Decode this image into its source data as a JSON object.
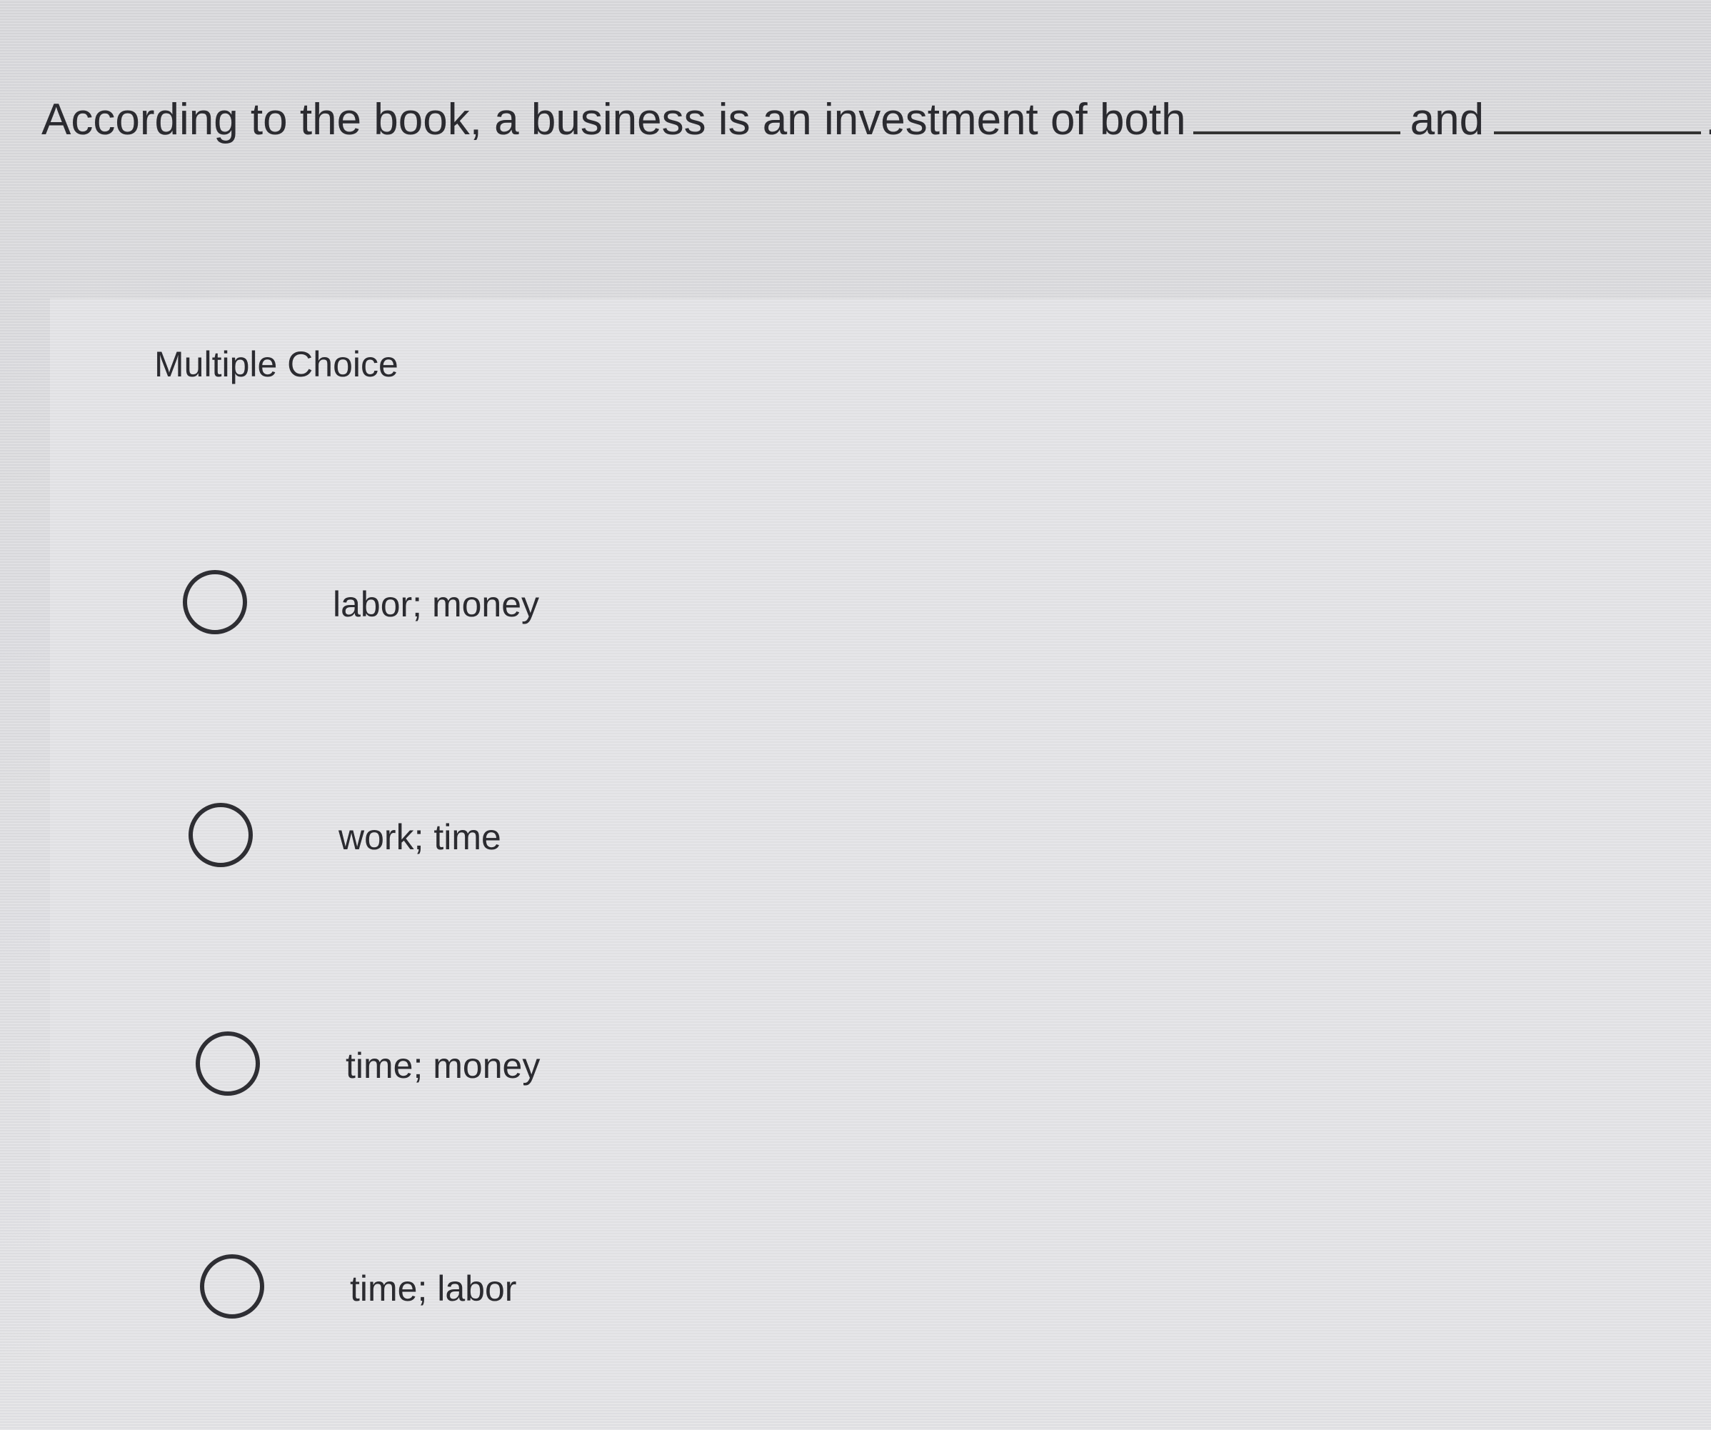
{
  "question": {
    "prefix": "According to the book, a business is an investment of both",
    "connector": "and",
    "suffix": "."
  },
  "section_label": "Multiple Choice",
  "options": [
    {
      "label": "labor; money"
    },
    {
      "label": "work; time"
    },
    {
      "label": "time; money"
    },
    {
      "label": "time; labor"
    }
  ]
}
